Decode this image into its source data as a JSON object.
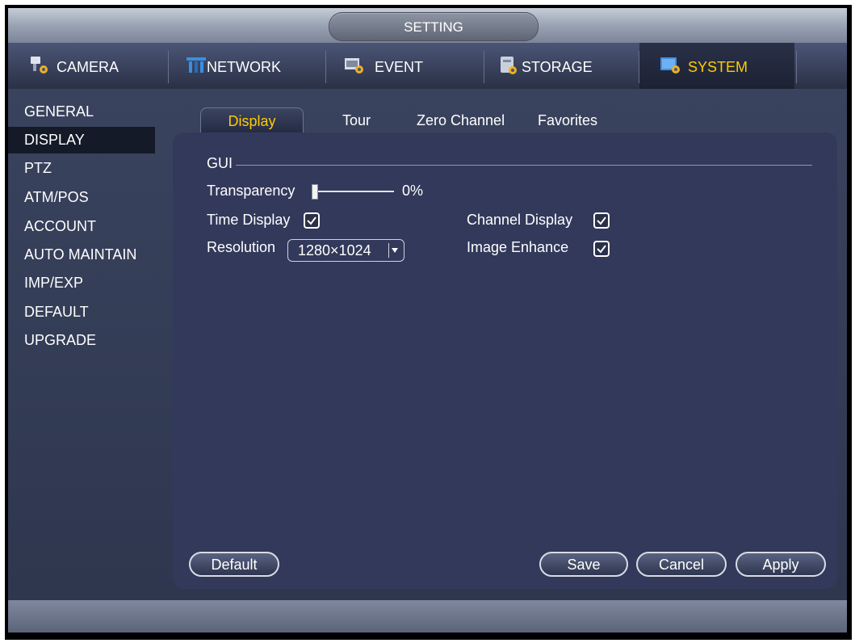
{
  "window": {
    "title": "SETTING"
  },
  "main_tabs": [
    {
      "label": "CAMERA",
      "icon": "camera-icon"
    },
    {
      "label": "NETWORK",
      "icon": "network-icon"
    },
    {
      "label": "EVENT",
      "icon": "event-icon"
    },
    {
      "label": "STORAGE",
      "icon": "storage-icon"
    },
    {
      "label": "SYSTEM",
      "icon": "system-icon",
      "active": true
    }
  ],
  "sidebar": {
    "items": [
      {
        "label": "GENERAL"
      },
      {
        "label": "DISPLAY",
        "active": true
      },
      {
        "label": "PTZ"
      },
      {
        "label": "ATM/POS"
      },
      {
        "label": "ACCOUNT"
      },
      {
        "label": "AUTO MAINTAIN"
      },
      {
        "label": "IMP/EXP"
      },
      {
        "label": "DEFAULT"
      },
      {
        "label": "UPGRADE"
      }
    ]
  },
  "sub_tabs": [
    {
      "label": "Display",
      "active": true
    },
    {
      "label": "Tour"
    },
    {
      "label": "Zero Channel"
    },
    {
      "label": "Favorites"
    }
  ],
  "gui": {
    "section_label": "GUI",
    "transparency": {
      "label": "Transparency",
      "value": "0%",
      "fraction": 0.0
    },
    "time_display": {
      "label": "Time Display",
      "checked": true
    },
    "channel_display": {
      "label": "Channel Display",
      "checked": true
    },
    "resolution": {
      "label": "Resolution",
      "value": "1280×1024"
    },
    "image_enhance": {
      "label": "Image Enhance",
      "checked": true
    }
  },
  "buttons": {
    "default": "Default",
    "save": "Save",
    "cancel": "Cancel",
    "apply": "Apply"
  },
  "colors": {
    "active_text": "#ffcc00",
    "panel_bg": "#32395a"
  }
}
